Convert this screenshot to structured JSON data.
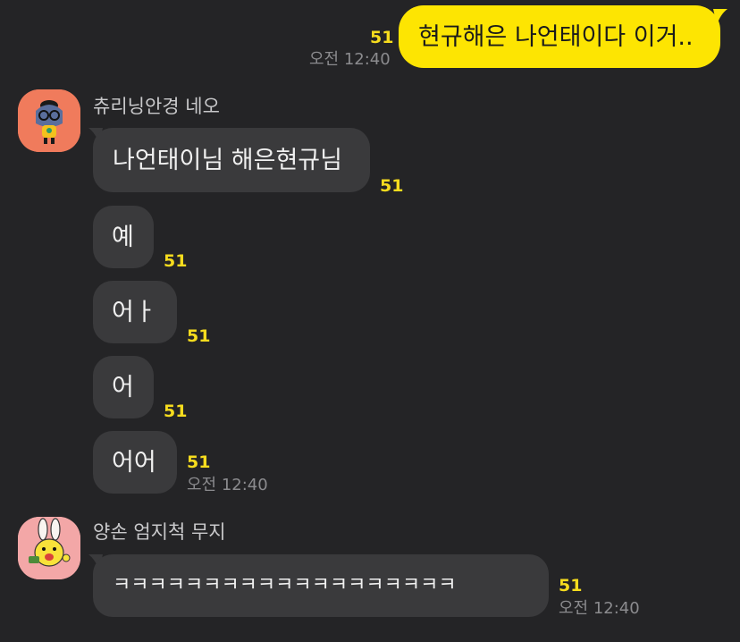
{
  "messages": {
    "m0": {
      "text": "현규해은 나언태이다 이거..",
      "count": "51",
      "time": "오전 12:40"
    },
    "m1": {
      "text": "나언태이님 해은현규님",
      "count": "51"
    },
    "m2": {
      "text": "예",
      "count": "51"
    },
    "m3": {
      "text": "어ㅏ",
      "count": "51"
    },
    "m4": {
      "text": "어",
      "count": "51"
    },
    "m5": {
      "text": "어어",
      "count": "51",
      "time": "오전 12:40"
    },
    "m6": {
      "text": "ㅋㅋㅋㅋㅋㅋㅋㅋㅋㅋㅋㅋㅋㅋㅋㅋㅋㅋㅋ",
      "count": "51",
      "time": "오전 12:40"
    }
  },
  "senders": {
    "s1": {
      "name": "츄리닝안경 네오",
      "avatar_icon": "neo-character-icon"
    },
    "s2": {
      "name": "양손 엄지척 무지",
      "avatar_icon": "muzi-character-icon"
    }
  },
  "colors": {
    "background": "#242426",
    "bubble_mine": "#fde502",
    "bubble_other": "#3a3a3c",
    "unread_count": "#f6dc1e"
  }
}
